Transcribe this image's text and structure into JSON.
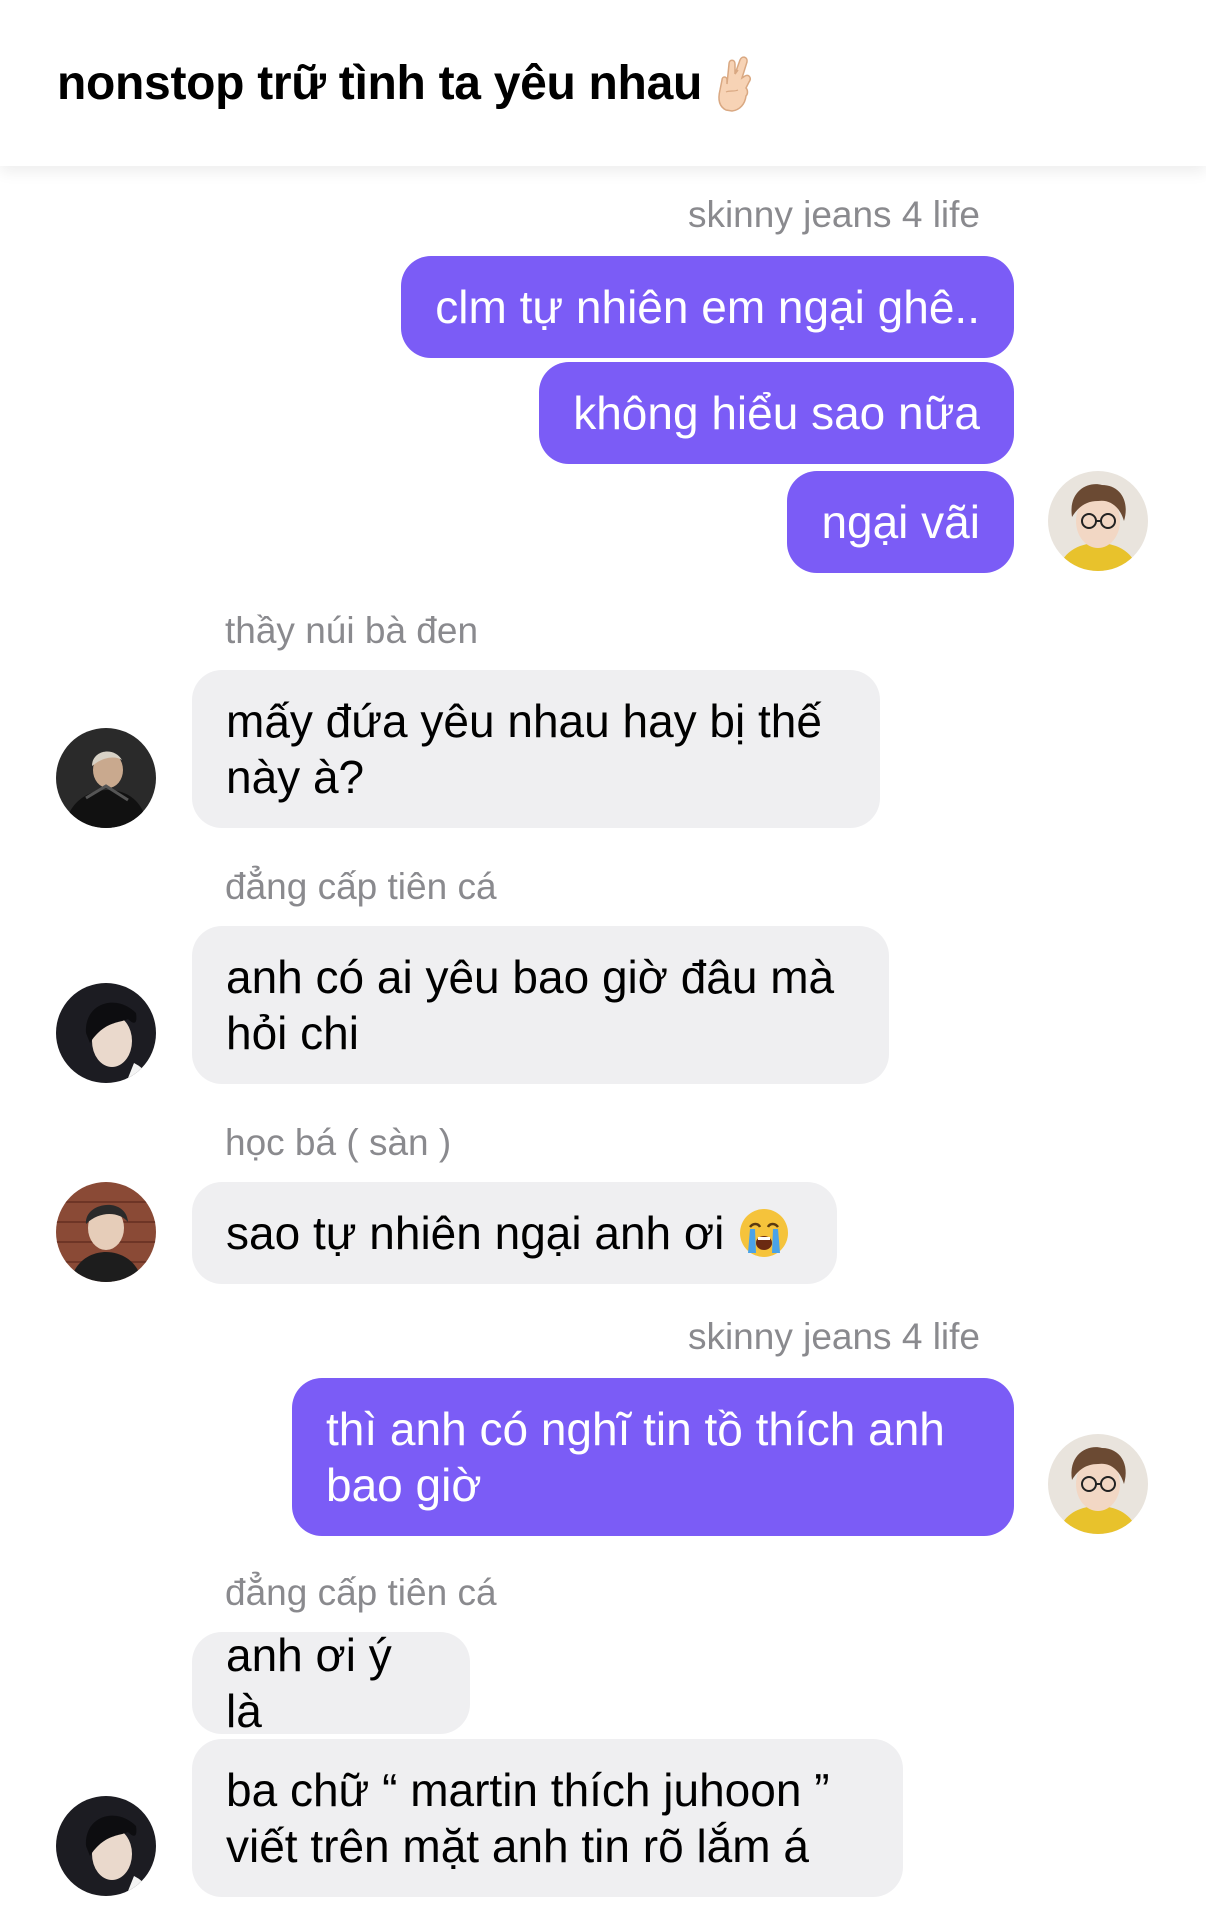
{
  "header": {
    "title": "nonstop trữ tình ta yêu nhau"
  },
  "messages": {
    "g1_sender": "skinny jeans 4 life",
    "g1_m1": "clm tự nhiên em ngại ghê..",
    "g1_m2": "không hiểu sao nữa",
    "g1_m3": "ngại vãi",
    "g2_sender": "thầy núi bà đen",
    "g2_m1": "mấy đứa yêu nhau hay bị thế này à?",
    "g3_sender": "đẳng cấp tiên cá",
    "g3_m1": "anh có ai yêu bao giờ đâu mà hỏi chi",
    "g4_sender": "học bá ( sàn )",
    "g4_m1": "sao tự nhiên ngại anh ơi",
    "g5_sender": "skinny jeans 4 life",
    "g5_m1": "thì anh có nghĩ tin tồ thích anh bao giờ",
    "g6_sender": "đẳng cấp tiên cá",
    "g6_m1": "anh ơi ý là",
    "g6_m2": "ba chữ “ martin thích juhoon ” viết trên mặt anh tin rõ lắm á"
  },
  "icons": {
    "header_emoji": "crossed-fingers-icon",
    "crying_emoji": "loudly-crying-face-icon"
  },
  "colors": {
    "outgoing_bubble": "#7b5cf6",
    "incoming_bubble": "#efeff1",
    "sender_name": "#8a8a8e"
  }
}
